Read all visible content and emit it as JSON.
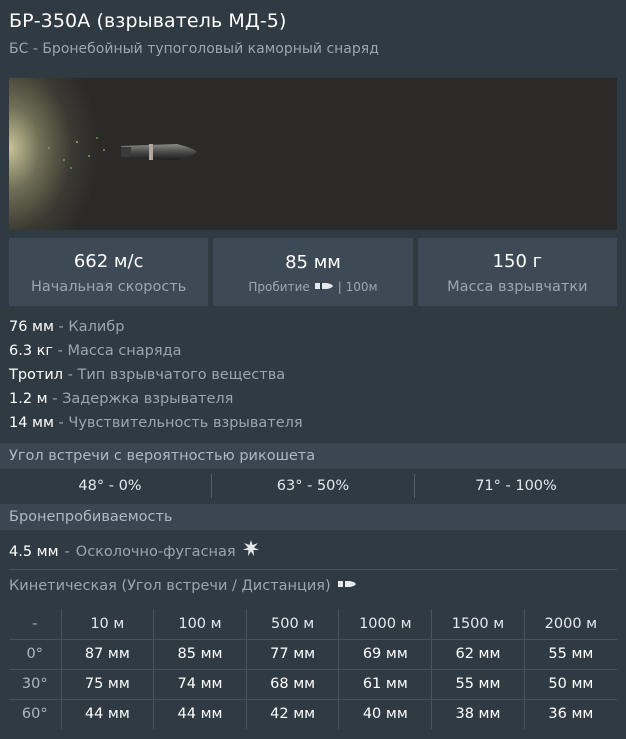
{
  "header": {
    "title": "БР-350А (взрыватель МД-5)",
    "subtitle": "БС - Бронебойный тупоголовый каморный снаряд"
  },
  "stats": [
    {
      "value": "662 м/с",
      "label": "Начальная скорость"
    },
    {
      "value": "85 мм",
      "label": "Пробитие",
      "suffix": "| 100м",
      "icon": "shell-icon"
    },
    {
      "value": "150 г",
      "label": "Масса взрывчатки"
    }
  ],
  "properties": [
    {
      "value": "76 мм",
      "desc": "Калибр"
    },
    {
      "value": "6.3 кг",
      "desc": "Масса снаряда"
    },
    {
      "value": "Тротил",
      "desc": "Тип взрывчатого вещества"
    },
    {
      "value": "1.2 м",
      "desc": "Задержка взрывателя"
    },
    {
      "value": "14 мм",
      "desc": "Чувствительность взрывателя"
    }
  ],
  "ricochet": {
    "title": "Угол встречи с вероятностью рикошета",
    "cells": [
      "48° - 0%",
      "63° - 50%",
      "71° - 100%"
    ]
  },
  "armor": {
    "title": "Бронепробиваемость",
    "he_value": "4.5 мм",
    "he_desc": "Осколочно-фугасная",
    "kinetic_title": "Кинетическая (Угол встречи / Дистанция)",
    "columns": [
      "-",
      "10 м",
      "100 м",
      "500 м",
      "1000 м",
      "1500 м",
      "2000 м"
    ],
    "rows": [
      {
        "angle": "0°",
        "values": [
          "87 мм",
          "85 мм",
          "77 мм",
          "69 мм",
          "62 мм",
          "55 мм"
        ]
      },
      {
        "angle": "30°",
        "values": [
          "75 мм",
          "74 мм",
          "68 мм",
          "61 мм",
          "55 мм",
          "50 мм"
        ]
      },
      {
        "angle": "60°",
        "values": [
          "44 мм",
          "44 мм",
          "42 мм",
          "40 мм",
          "38 мм",
          "36 мм"
        ]
      }
    ]
  },
  "colors": {
    "background": "#2f3a43",
    "panel": "#3d4a55",
    "section": "#3a4752",
    "muted_text": "#9aa6b0"
  }
}
